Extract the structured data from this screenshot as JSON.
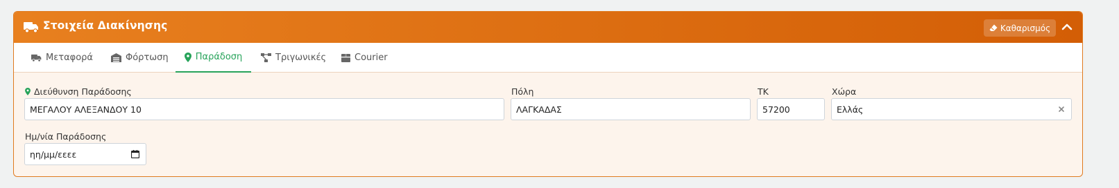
{
  "header": {
    "title": "Στοιχεία Διακίνησης",
    "clear_label": "Καθαρισμός",
    "accent_color": "#e07a1e"
  },
  "tabs": [
    {
      "label": "Μεταφορά",
      "icon": "truck-icon",
      "active": false
    },
    {
      "label": "Φόρτωση",
      "icon": "warehouse-icon",
      "active": false
    },
    {
      "label": "Παράδοση",
      "icon": "map-pin-icon",
      "active": true
    },
    {
      "label": "Τριγωνικές",
      "icon": "network-icon",
      "active": false
    },
    {
      "label": "Courier",
      "icon": "box-icon",
      "active": false
    }
  ],
  "form": {
    "address": {
      "label": "Διεύθυνση Παράδοσης",
      "value": "ΜΕΓΑΛΟΥ ΑΛΕΞΑΝΔΟΥ 10"
    },
    "city": {
      "label": "Πόλη",
      "value": "ΛΑΓΚΑΔΑΣ"
    },
    "postal_code": {
      "label": "ΤΚ",
      "value": "57200"
    },
    "country": {
      "label": "Χώρα",
      "value": "Ελλάς"
    },
    "delivery_date": {
      "label": "Ημ/νία Παράδοσης",
      "placeholder": "ηη/μμ/εεεε"
    }
  },
  "active_color": "#27a35a"
}
